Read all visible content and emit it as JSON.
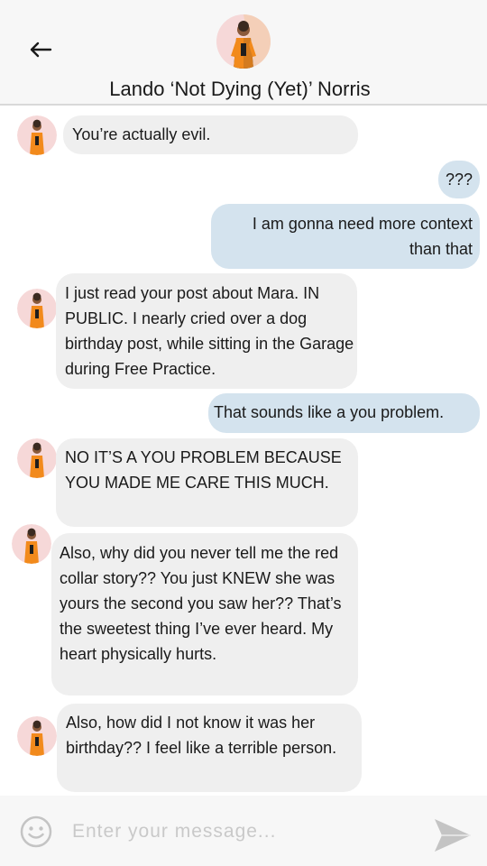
{
  "header": {
    "back_icon": "arrow-left-icon",
    "contact_name": "Lando ‘Not Dying (Yet)’ Norris",
    "avatar_icon": "contact-avatar"
  },
  "messages": [
    {
      "direction": "incoming",
      "text": "You’re actually evil."
    },
    {
      "direction": "outgoing",
      "text": "???"
    },
    {
      "direction": "outgoing",
      "text": "I am gonna need more context than that"
    },
    {
      "direction": "incoming",
      "text": "I just read your post about Mara. IN PUBLIC. I nearly cried over a dog birthday post, while sitting in the Garage during Free Practice."
    },
    {
      "direction": "outgoing",
      "text": "That sounds like a you problem."
    },
    {
      "direction": "incoming",
      "text": "NO IT’S A YOU PROBLEM BECAUSE YOU MADE ME CARE THIS MUCH."
    },
    {
      "direction": "incoming",
      "text": "Also, why did you never tell me the red collar story?? You just KNEW she was yours the second you saw her?? That’s the sweetest thing I’ve ever heard. My heart physically hurts."
    },
    {
      "direction": "incoming",
      "text": "Also, how did I not know it was her birthday?? I feel like a terrible person."
    }
  ],
  "composer": {
    "emoji_icon": "smiley-icon",
    "placeholder": "Enter your message...",
    "value": "",
    "send_icon": "send-icon"
  },
  "colors": {
    "header_bg": "#f7f7f7",
    "incoming_bubble": "#efefef",
    "outgoing_bubble": "#d4e3ee",
    "avatar_bg": "#f6d8d8",
    "jacket_orange": "#f28a1c"
  }
}
